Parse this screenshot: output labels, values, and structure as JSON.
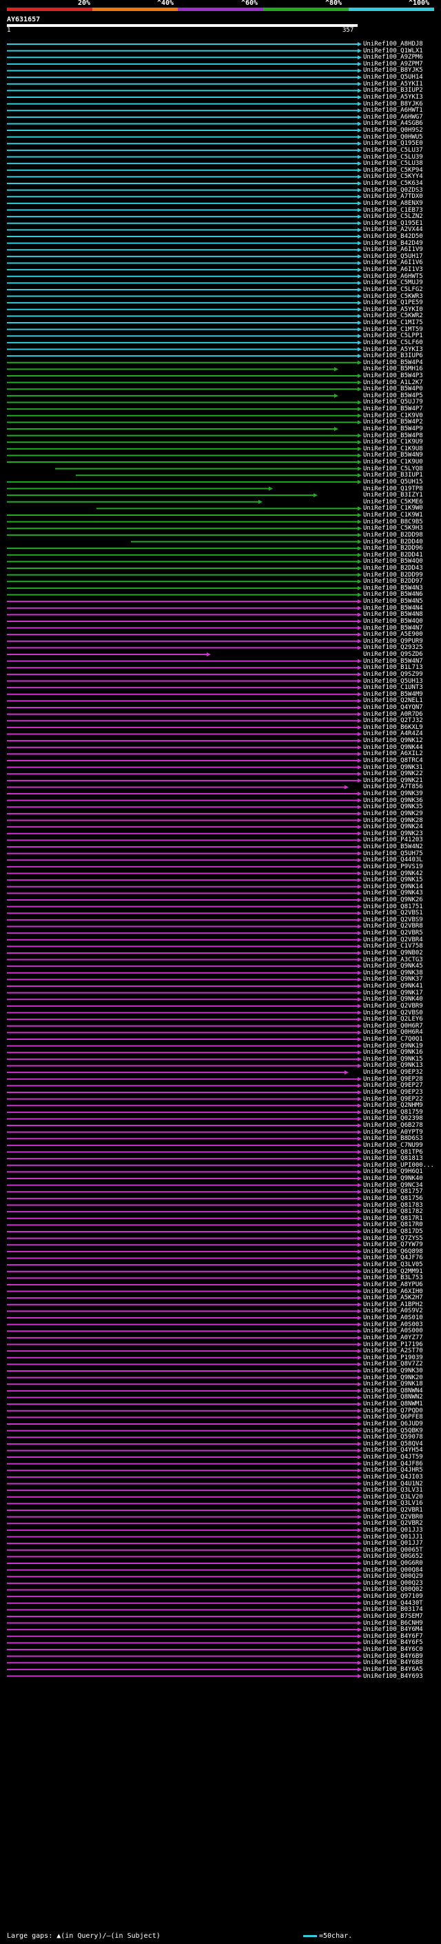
{
  "query": {
    "name": "AY631657",
    "start": "1",
    "end": "357"
  },
  "scale": {
    "labels": [
      "20%",
      "^40%",
      "^60%",
      "^80%",
      "^100%"
    ],
    "colors": [
      "#dd2222",
      "#ee7711",
      "#9933cc",
      "#22aa22",
      "#33ccdd"
    ]
  },
  "colors": {
    "cyan": "#33ccdd",
    "green": "#22aa22",
    "magenta": "#cc33cc"
  },
  "hits": [
    "UniRef100_A8HDJ8",
    "UniRef100_Q1WLX1",
    "UniRef100_A9ZPM6",
    "UniRef100_A9ZPM7",
    "UniRef100_B8YJK5",
    "UniRef100_Q5UH14",
    "UniRef100_A5YKI1",
    "UniRef100_B3IUP2",
    "UniRef100_A5YKI3",
    "UniRef100_B8YJK6",
    "UniRef100_A6HWT1",
    "UniRef100_A6HWG7",
    "UniRef100_A4SGB6",
    "UniRef100_Q0H9S2",
    "UniRef100_Q0HWU5",
    "UniRef100_Q195E0",
    "UniRef100_C5LU37",
    "UniRef100_C5LU39",
    "UniRef100_C5LU38",
    "UniRef100_C5KP94",
    "UniRef100_C5KYY4",
    "UniRef100_C5K634",
    "UniRef100_Q0ZDS3",
    "UniRef100_A7TDX0",
    "UniRef100_A8ENX9",
    "UniRef100_C1EB73",
    "UniRef100_C5LZN2",
    "UniRef100_Q195E1",
    "UniRef100_A2VX44",
    "UniRef100_B42D50",
    "UniRef100_B42D49",
    "UniRef100_A6I1V9",
    "UniRef100_Q5UH17",
    "UniRef100_A6I1V6",
    "UniRef100_A6I1V3",
    "UniRef100_A6HWT5",
    "UniRef100_C5MUJ9",
    "UniRef100_C5LFG2",
    "UniRef100_C5KWR3",
    "UniRef100_Q1PE59",
    "UniRef100_A5YKI0",
    "UniRef100_C5KWR2",
    "UniRef100_C1MI75",
    "UniRef100_C1MT59",
    "UniRef100_C5LPP1",
    "UniRef100_C5LF60",
    "UniRef100_A5YKI3",
    "UniRef100_B3IUP6",
    "UniRef100_B5W4P4",
    "UniRef100_B5MH16",
    "UniRef100_B5W4P3",
    "UniRef100_A1L2K7",
    "UniRef100_B5W4P0",
    "UniRef100_B5W4P5",
    "UniRef100_Q5UJ79",
    "UniRef100_B5W4P7",
    "UniRef100_C1K9V0",
    "UniRef100_B5W4P2",
    "UniRef100_B5W4P9",
    "UniRef100_B5W4P8",
    "UniRef100_C1K9U9",
    "UniRef100_C1K9U8",
    "UniRef100_B5W4N9",
    "UniRef100_C1K9U0",
    "UniRef100_C5LYQ8",
    "UniRef100_B3IUP1",
    "UniRef100_Q5UH15",
    "UniRef100_Q19TP8",
    "UniRef100_B3IZY1",
    "UniRef100_C5KME6",
    "UniRef100_C1K9W0",
    "UniRef100_C1K9W1",
    "UniRef100_B8C9B5",
    "UniRef100_C5K9H3",
    "UniRef100_B2DD98",
    "UniRef100_B2DD40",
    "UniRef100_B2DD96",
    "UniRef100_B2DD41",
    "UniRef100_B5W4Q0",
    "UniRef100_B2DD43",
    "UniRef100_B2DD99",
    "UniRef100_B2DD97",
    "UniRef100_B5W4N3",
    "UniRef100_B5W4N6",
    "UniRef100_B5W4N5",
    "UniRef100_B5W4N4",
    "UniRef100_B5W4N8",
    "UniRef100_B5W4Q0",
    "UniRef100_B5W4N7",
    "UniRef100_A5E900",
    "UniRef100_Q9PUR9",
    "UniRef100_Q29325",
    "UniRef100_Q9SZD6",
    "UniRef100_B5W4N7",
    "UniRef100_B1L713",
    "UniRef100_Q9SZ99",
    "UniRef100_Q5UH13",
    "UniRef100_C1UNT3",
    "UniRef100_B5W4M9",
    "UniRef100_Q2NEL1",
    "UniRef100_Q4YQN7",
    "UniRef100_A0R7D6",
    "UniRef100_Q2TJ32",
    "UniRef100_B6KXL9",
    "UniRef100_A4R4Z4",
    "UniRef100_Q9NK12",
    "UniRef100_Q9NK44",
    "UniRef100_A6XIL2",
    "UniRef100_Q8TRC4",
    "UniRef100_Q9NK31",
    "UniRef100_Q9NK22",
    "UniRef100_Q9NK21",
    "UniRef100_A7T856",
    "UniRef100_Q9NK39",
    "UniRef100_Q9NK36",
    "UniRef100_Q9NK35",
    "UniRef100_Q9NK29",
    "UniRef100_Q9NK28",
    "UniRef100_Q9NK24",
    "UniRef100_Q9NK23",
    "UniRef100_P41203",
    "UniRef100_B5W4N2",
    "UniRef100_Q5UH75",
    "UniRef100_Q4403L",
    "UniRef100_P9VS19",
    "UniRef100_Q9NK42",
    "UniRef100_Q9NK15",
    "UniRef100_Q9NK14",
    "UniRef100_Q9NK43",
    "UniRef100_Q9NK26",
    "UniRef100_Q81751",
    "UniRef100_Q2VBS1",
    "UniRef100_Q2VBS9",
    "UniRef100_Q2VBR8",
    "UniRef100_Q2VBR5",
    "UniRef100_Q2VBR4",
    "UniRef100_C1V758",
    "UniRef100_Q9NB02",
    "UniRef100_A3CTG3",
    "UniRef100_Q9NK45",
    "UniRef100_Q9NK38",
    "UniRef100_Q9NK37",
    "UniRef100_Q9NK41",
    "UniRef100_Q9NK17",
    "UniRef100_Q9NK40",
    "UniRef100_Q2VBR9",
    "UniRef100_Q2VBS0",
    "UniRef100_Q2LEY6",
    "UniRef100_Q0H6R7",
    "UniRef100_Q0H6R4",
    "UniRef100_C7Q0Q1",
    "UniRef100_Q9NK19",
    "UniRef100_Q9NK16",
    "UniRef100_Q9NK15",
    "UniRef100_Q9NK13",
    "UniRef100_Q9EP32",
    "UniRef100_Q9EP28",
    "UniRef100_Q9EP27",
    "UniRef100_Q9EP23",
    "UniRef100_Q9EP22",
    "UniRef100_Q2NHM9",
    "UniRef100_Q81759",
    "UniRef100_Q02398",
    "UniRef100_Q6B278",
    "UniRef100_A0YPT9",
    "UniRef100_B8D6S3",
    "UniRef100_C7NU99",
    "UniRef100_Q81TP6",
    "UniRef100_Q81813",
    "UniRef100_UPI000...",
    "UniRef100_Q9H6Q1",
    "UniRef100_Q9NK40",
    "UniRef100_Q9NC34",
    "UniRef100_Q81757",
    "UniRef100_Q81756",
    "UniRef100_Q81783",
    "UniRef100_Q81782",
    "UniRef100_Q817R1",
    "UniRef100_Q817R0",
    "UniRef100_Q817D5",
    "UniRef100_Q7ZYS5",
    "UniRef100_Q7YW79",
    "UniRef100_Q6Q898",
    "UniRef100_Q4JF76",
    "UniRef100_Q3LV05",
    "UniRef100_Q2MM91",
    "UniRef100_B3L753",
    "UniRef100_A8YPU6",
    "UniRef100_A6XIH0",
    "UniRef100_A5K2H7",
    "UniRef100_A1BPH2",
    "UniRef100_A0S9V2",
    "UniRef100_A0S010",
    "UniRef100_A0S003",
    "UniRef100_A0S000",
    "UniRef100_A0YZ77",
    "UniRef100_P17196",
    "UniRef100_A2ST70",
    "UniRef100_P19039",
    "UniRef100_Q8V7Z2",
    "UniRef100_Q9NK30",
    "UniRef100_Q9NK20",
    "UniRef100_Q9NK18",
    "UniRef100_Q8NWN4",
    "UniRef100_Q8NWN2",
    "UniRef100_Q8NWM1",
    "UniRef100_Q7PQD0",
    "UniRef100_Q6PFE8",
    "UniRef100_Q6JUD9",
    "UniRef100_Q5QBK9",
    "UniRef100_Q59078",
    "UniRef100_Q58QV4",
    "UniRef100_Q4YH54",
    "UniRef100_Q4JT59",
    "UniRef100_Q4JF86",
    "UniRef100_Q4JHR5",
    "UniRef100_Q4JI03",
    "UniRef100_Q4U1N2",
    "UniRef100_Q3LV31",
    "UniRef100_Q3LV20",
    "UniRef100_Q3LV16",
    "UniRef100_Q2VBR1",
    "UniRef100_Q2VBR0",
    "UniRef100_Q2VBR2",
    "UniRef100_Q01JJ3",
    "UniRef100_Q01JJ1",
    "UniRef100_Q01JJ7",
    "UniRef100_Q0065T",
    "UniRef100_Q0G652",
    "UniRef100_Q0G6R0",
    "UniRef100_Q00Q84",
    "UniRef100_Q00Q29",
    "UniRef100_Q00Q23",
    "UniRef100_Q00Q02",
    "UniRef100_Q97109",
    "UniRef100_Q4430T",
    "UniRef100_B03174",
    "UniRef100_B7SEM7",
    "UniRef100_B6CNH9",
    "UniRef100_B4Y6M4",
    "UniRef100_B4Y6F7",
    "UniRef100_B4Y6F5",
    "UniRef100_B4Y6C0",
    "UniRef100_B4Y6B9",
    "UniRef100_B4Y6B8",
    "UniRef100_B4Y6A5",
    "UniRef100_B4Y693"
  ],
  "legend": {
    "gaps": "Large gaps: ▲(in Query)/—(in Subject)",
    "scale": "=50char."
  }
}
